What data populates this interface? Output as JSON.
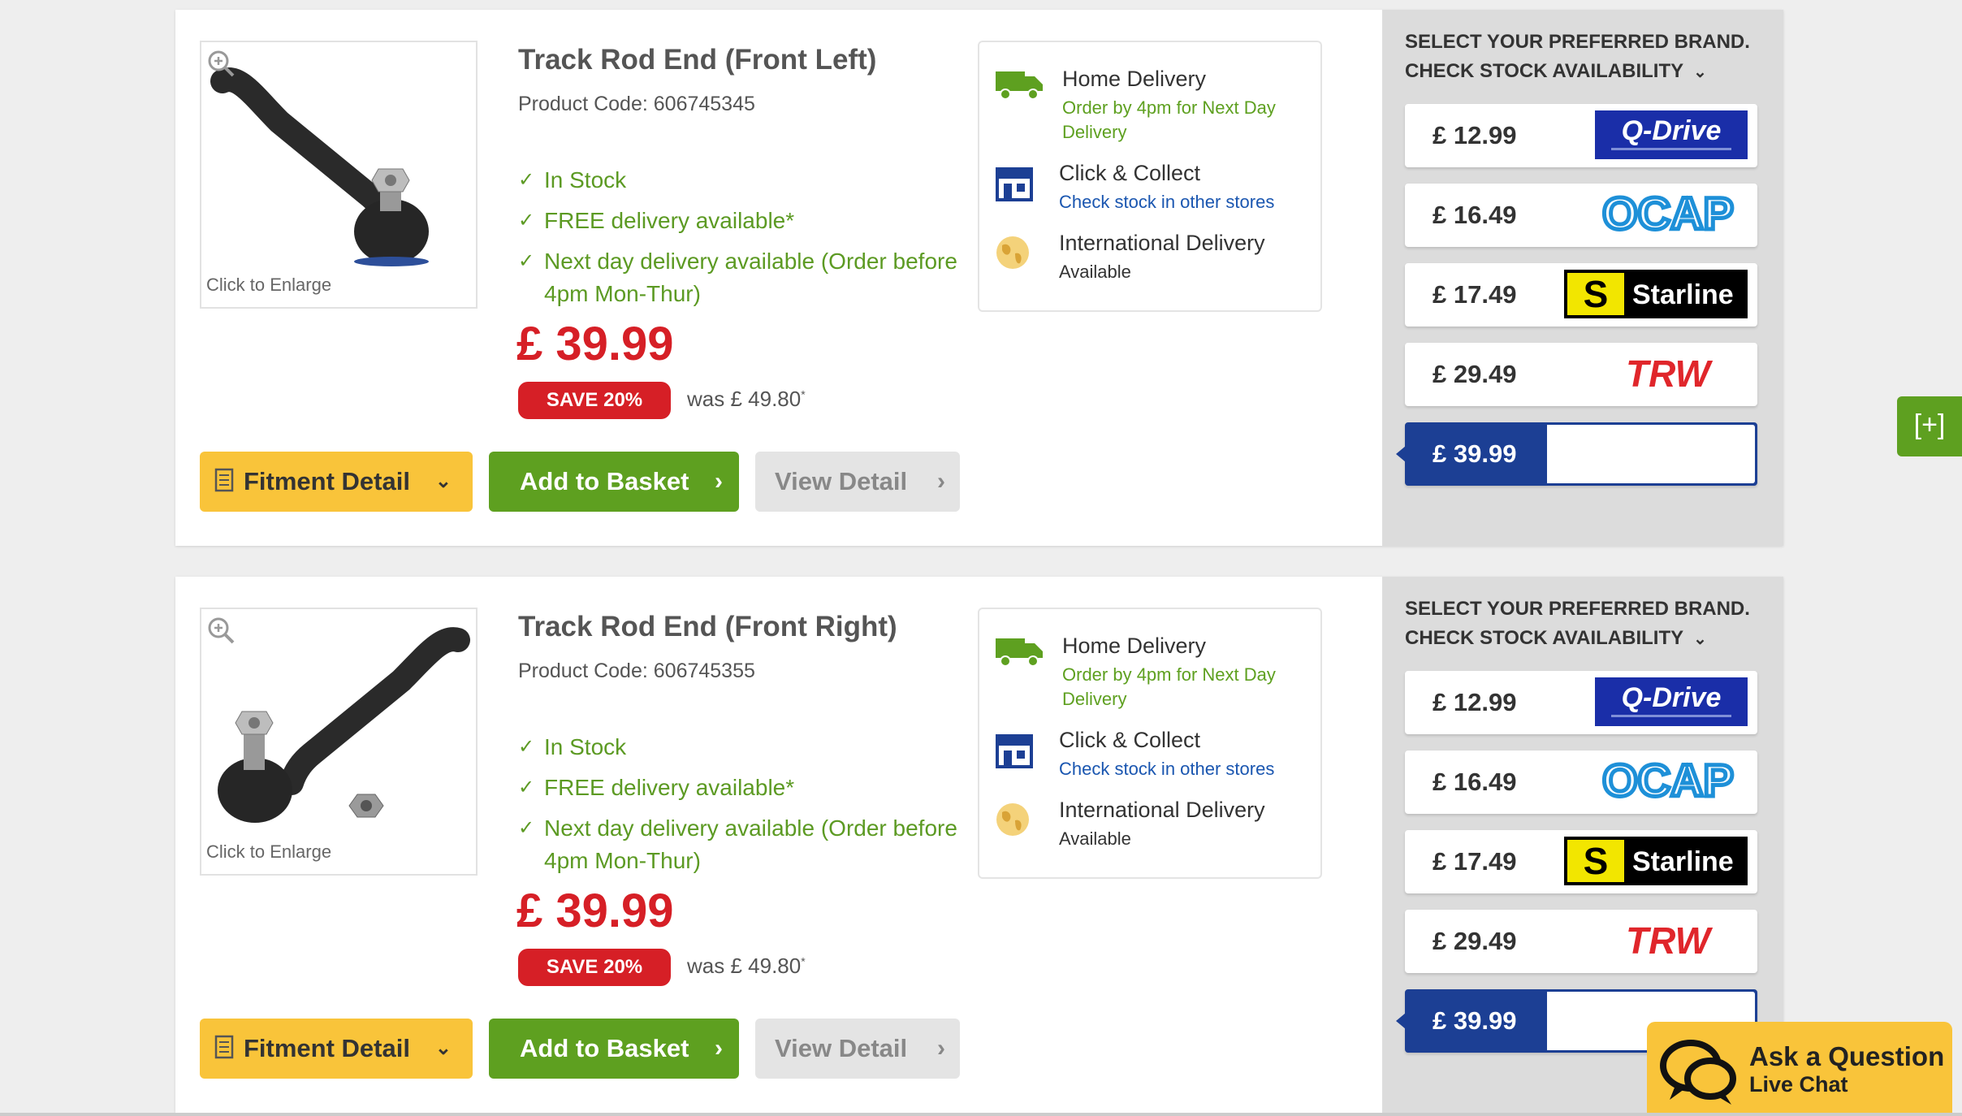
{
  "products": [
    {
      "title": "Track Rod End (Front Left)",
      "code": "Product Code: 606745345",
      "enlarge": "Click to Enlarge",
      "features": [
        "In Stock",
        "FREE delivery available*",
        "Next day delivery available (Order before",
        "4pm Mon-Thur)"
      ],
      "price": "£ 39.99",
      "save": "SAVE  20%",
      "was": "was  £ 49.80",
      "was_mark": "*",
      "buttons": {
        "fitment": "Fitment Detail",
        "add": "Add to Basket",
        "view": "View Detail"
      },
      "delivery": {
        "home_title": "Home Delivery",
        "home_sub1": "Order by 4pm for Next Day",
        "home_sub2": "Delivery",
        "collect_title": "Click & Collect",
        "collect_sub": "Check stock in other stores",
        "intl_title": "International Delivery",
        "intl_sub": "Available"
      },
      "brand_header1": "SELECT YOUR PREFERRED BRAND.",
      "brand_header2": "CHECK STOCK AVAILABILITY",
      "brands": [
        {
          "price": "£ 12.99",
          "brand": "Q-Drive"
        },
        {
          "price": "£ 16.49",
          "brand": "OCAP"
        },
        {
          "price": "£ 17.49",
          "brand": "Starline"
        },
        {
          "price": "£ 29.49",
          "brand": "TRW"
        },
        {
          "price": "£ 39.99",
          "brand": ""
        }
      ]
    },
    {
      "title": "Track Rod End (Front Right)",
      "code": "Product Code: 606745355",
      "enlarge": "Click to Enlarge",
      "features": [
        "In Stock",
        "FREE delivery available*",
        "Next day delivery available (Order before",
        "4pm Mon-Thur)"
      ],
      "price": "£ 39.99",
      "save": "SAVE  20%",
      "was": "was  £ 49.80",
      "was_mark": "*",
      "buttons": {
        "fitment": "Fitment Detail",
        "add": "Add to Basket",
        "view": "View Detail"
      },
      "delivery": {
        "home_title": "Home Delivery",
        "home_sub1": "Order by 4pm for Next Day",
        "home_sub2": "Delivery",
        "collect_title": "Click & Collect",
        "collect_sub": "Check stock in other stores",
        "intl_title": "International Delivery",
        "intl_sub": "Available"
      },
      "brand_header1": "SELECT YOUR PREFERRED BRAND.",
      "brand_header2": "CHECK STOCK AVAILABILITY",
      "brands": [
        {
          "price": "£ 12.99",
          "brand": "Q-Drive"
        },
        {
          "price": "£ 16.49",
          "brand": "OCAP"
        },
        {
          "price": "£ 17.49",
          "brand": "Starline"
        },
        {
          "price": "£ 29.49",
          "brand": "TRW"
        },
        {
          "price": "£ 39.99",
          "brand": ""
        }
      ]
    }
  ],
  "side_tab": "[+]",
  "chat": {
    "line1": "Ask a Question",
    "line2": "Live Chat"
  },
  "colors": {
    "price_red": "#d61f26",
    "green": "#5ea020",
    "yellow": "#f9c43a",
    "navy": "#1c3f94",
    "link_blue": "#1a56b0"
  }
}
